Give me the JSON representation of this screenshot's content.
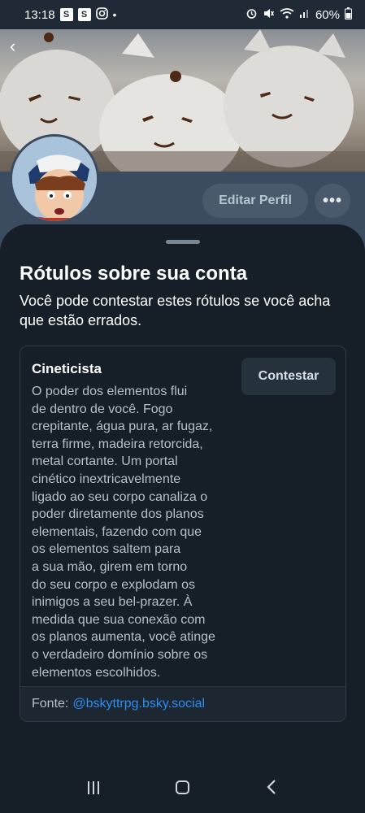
{
  "statusbar": {
    "time": "13:18",
    "battery": "60%",
    "notif_1": "S",
    "notif_2": "S",
    "icons": [
      "signal-s-icon",
      "signal-s-icon",
      "instagram-icon",
      "dot-icon",
      "alarm-icon",
      "mute-icon",
      "wifi-icon",
      "cell-signal-icon",
      "battery-icon"
    ]
  },
  "profile": {
    "edit_label": "Editar Perfil",
    "more_label": "•••"
  },
  "sheet": {
    "title": "Rótulos sobre sua conta",
    "subtitle": "Você pode contestar estes rótulos se você acha que estão errados.",
    "label": {
      "name": "Cineticista",
      "description": "O poder dos elementos flui\nde dentro de você. Fogo\ncrepitante, água pura, ar fugaz,\nterra firme, madeira retorcida,\nmetal cortante. Um portal\ncinético inextricavelmente\nligado ao seu corpo canaliza o\npoder diretamente dos planos\nelementais, fazendo com que\nos elementos saltem para\na sua mão, girem em torno\ndo seu corpo e explodam os\ninimigos a seu bel-prazer. À\nmedida que sua conexão com\nos planos aumenta, você atinge\no verdadeiro domínio sobre os\nelementos escolhidos.",
      "contest_label": "Contestar",
      "source_prefix": "Fonte:",
      "source_link": "@bskyttrpg.bsky.social"
    }
  },
  "colors": {
    "accent": "#2f8cf0",
    "sheet_bg": "#161e27",
    "profile_bg": "#3b4b60"
  }
}
